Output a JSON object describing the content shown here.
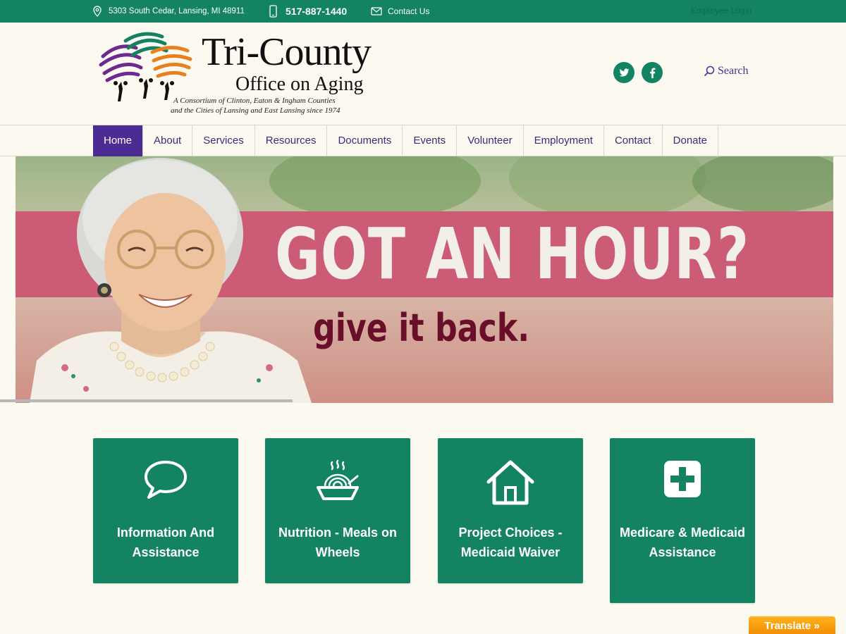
{
  "topbar": {
    "address": "5303 South Cedar, Lansing, MI 48911",
    "phone": "517-887-1440",
    "contact_label": "Contact Us",
    "employee_login": "Employee Login",
    "icons": {
      "address": "map-pin-icon",
      "phone": "mobile-phone-icon",
      "contact": "envelope-icon"
    }
  },
  "header": {
    "brand_line1": "Tri-County",
    "brand_line2": "Office on Aging",
    "tagline1": "A Consortium of Clinton, Eaton & Ingham Counties",
    "tagline2": "and the Cities of Lansing and East Lansing since 1974",
    "search_label": "Search",
    "social": [
      "twitter-icon",
      "facebook-icon"
    ]
  },
  "nav": {
    "items": [
      {
        "label": "Home",
        "active": true
      },
      {
        "label": "About"
      },
      {
        "label": "Services"
      },
      {
        "label": "Resources"
      },
      {
        "label": "Documents"
      },
      {
        "label": "Events"
      },
      {
        "label": "Volunteer"
      },
      {
        "label": "Employment"
      },
      {
        "label": "Contact"
      },
      {
        "label": "Donate"
      }
    ]
  },
  "hero": {
    "headline": "GOT AN HOUR?",
    "subheadline": "give it back."
  },
  "cards": [
    {
      "label": "Information And Assistance",
      "icon": "speech-bubble-icon"
    },
    {
      "label": "Nutrition - Meals on Wheels",
      "icon": "meal-bowl-icon"
    },
    {
      "label": "Project Choices - Medicaid Waiver",
      "icon": "house-icon"
    },
    {
      "label": "Medicare & Medicaid Assistance",
      "icon": "medical-plus-icon"
    }
  ],
  "translate_label": "Translate »",
  "colors": {
    "brand_green": "#138363",
    "nav_purple": "#4b2c92",
    "hero_band": "#cc5b75",
    "background": "#fcf9f0"
  }
}
